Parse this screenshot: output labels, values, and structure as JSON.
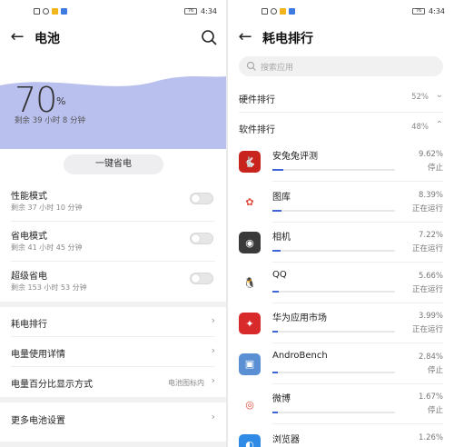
{
  "status_bar": {
    "time": "4:34",
    "battery_level": "76"
  },
  "battery_screen": {
    "title": "电池",
    "level": "70",
    "percent_sign": "%",
    "remaining": "剩余 39 小时 8 分钟",
    "one_key_save": "一键省电",
    "modes": [
      {
        "name": "性能模式",
        "remaining": "剩余 37 小时 10 分钟",
        "enabled": false
      },
      {
        "name": "省电模式",
        "remaining": "剩余 41 小时 45 分钟",
        "enabled": false
      },
      {
        "name": "超级省电",
        "remaining": "剩余 153 小时 53 分钟",
        "enabled": false
      }
    ],
    "menu": {
      "ranking": "耗电排行",
      "usage_details": "电量使用详情",
      "percent_display": "电量百分比显示方式",
      "percent_display_value": "电池图标内",
      "more_settings": "更多电池设置"
    }
  },
  "ranking_screen": {
    "title": "耗电排行",
    "search_placeholder": "搜索应用",
    "hardware": {
      "label": "硬件排行",
      "value": "52%"
    },
    "software": {
      "label": "软件排行",
      "value": "48%"
    },
    "apps": [
      {
        "name": "安兔兔评测",
        "percent": "9.62%",
        "status": "停止",
        "usage": 0.0962,
        "icon": "antutu-icon",
        "color": "#c8241d",
        "glyph": "🐇"
      },
      {
        "name": "图库",
        "percent": "8.39%",
        "status": "正在运行",
        "usage": 0.0839,
        "icon": "gallery-icon",
        "color": "#ffffff",
        "glyph": "✿"
      },
      {
        "name": "相机",
        "percent": "7.22%",
        "status": "正在运行",
        "usage": 0.0722,
        "icon": "camera-icon",
        "color": "#3a3a3a",
        "glyph": "◉"
      },
      {
        "name": "QQ",
        "percent": "5.66%",
        "status": "正在运行",
        "usage": 0.0566,
        "icon": "qq-penguin-icon",
        "color": "#ffffff",
        "glyph": "🐧"
      },
      {
        "name": "华为应用市场",
        "percent": "3.99%",
        "status": "正在运行",
        "usage": 0.0399,
        "icon": "appgallery-icon",
        "color": "#d8292b",
        "glyph": "✦"
      },
      {
        "name": "AndroBench",
        "percent": "2.84%",
        "status": "停止",
        "usage": 0.0284,
        "icon": "androbench-icon",
        "color": "#5b8fd4",
        "glyph": "▣"
      },
      {
        "name": "微博",
        "percent": "1.67%",
        "status": "停止",
        "usage": 0.0167,
        "icon": "weibo-icon",
        "color": "#ffffff",
        "glyph": "◎"
      },
      {
        "name": "浏览器",
        "percent": "1.26%",
        "status": "",
        "usage": 0.0126,
        "icon": "browser-icon",
        "color": "#2f8be6",
        "glyph": "◐"
      }
    ]
  },
  "colors": {
    "accent": "#3f65d9",
    "wave": "#b9c0ee"
  }
}
